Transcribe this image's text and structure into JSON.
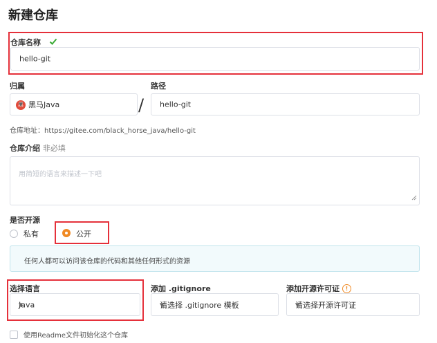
{
  "page": {
    "title": "新建仓库"
  },
  "repo_name": {
    "label": "仓库名称",
    "check_icon": "check-icon",
    "value": "hello-git"
  },
  "owner": {
    "label": "归属",
    "avatar_text": "黑",
    "value": "黑马Java",
    "separator": "/"
  },
  "path": {
    "label": "路径",
    "value": "hello-git"
  },
  "repo_address": {
    "text": "仓库地址：https://gitee.com/black_horse_java/hello-git"
  },
  "description": {
    "label": "仓库介绍",
    "optional": "非必填",
    "placeholder": "用简短的语言来描述一下吧"
  },
  "visibility": {
    "label": "是否开源",
    "options": [
      "私有",
      "公开"
    ],
    "selected": "公开",
    "notice": "任何人都可以访问该仓库的代码和其他任何形式的资源"
  },
  "language": {
    "label": "选择语言",
    "value": "Java"
  },
  "gitignore": {
    "label": "添加 .gitignore",
    "placeholder": "请选择 .gitignore 模板"
  },
  "license": {
    "label": "添加开源许可证",
    "info_icon": "info-icon",
    "placeholder": "请选择开源许可证"
  },
  "readme": {
    "label": "使用Readme文件初始化这个仓库"
  },
  "colors": {
    "accent": "#f08a24",
    "highlight_border": "#e5303a",
    "check": "#3aaa35",
    "avatar": "#e14b3b"
  }
}
